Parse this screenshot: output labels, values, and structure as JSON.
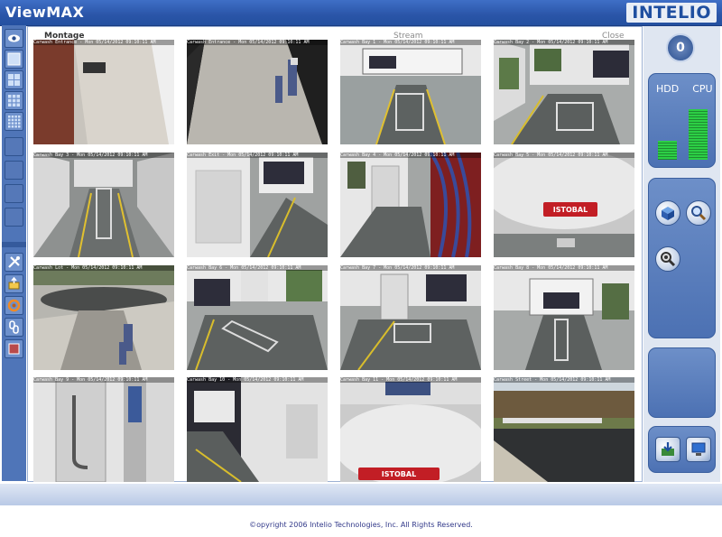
{
  "app": {
    "title": "ViewMAX",
    "logo_text": "INTELIO"
  },
  "tabs": [
    {
      "label": "Montage",
      "active": true
    },
    {
      "label": "Stream",
      "active": false
    },
    {
      "label": "Close",
      "active": false
    }
  ],
  "left_toolbar": {
    "view_buttons": [
      "eye-icon",
      "single-view-icon",
      "quad-view-icon",
      "nine-view-icon",
      "sixteen-view-icon"
    ],
    "tool_buttons": [
      "tools-icon",
      "export-icon",
      "refresh-icon",
      "link-icon",
      "record-icon"
    ]
  },
  "cameras": [
    {
      "stamp": "Carwash Entrance - Mon 05/14/2012 09:10:11 AM"
    },
    {
      "stamp": "Carwash Entrance - Mon 05/14/2012 09:10:11 AM"
    },
    {
      "stamp": "Carwash Bay 1 - Mon 05/14/2012 09:10:11 AM"
    },
    {
      "stamp": "Carwash Bay 2 - Mon 05/14/2012 09:10:11 AM"
    },
    {
      "stamp": "Carwash Bay 3 - Mon 05/14/2012 09:10:11 AM"
    },
    {
      "stamp": "Carwash Exit - Mon 05/14/2012 09:10:11 AM"
    },
    {
      "stamp": "Carwash Bay 4 - Mon 05/14/2012 09:10:11 AM"
    },
    {
      "stamp": "Carwash Bay 5 - Mon 05/14/2012 09:10:11 AM"
    },
    {
      "stamp": "Carwash Lot - Mon 05/14/2012 09:10:11 AM"
    },
    {
      "stamp": "Carwash Bay 6 - Mon 05/14/2012 09:10:11 AM"
    },
    {
      "stamp": "Carwash Bay 7 - Mon 05/14/2012 09:10:11 AM"
    },
    {
      "stamp": "Carwash Bay 8 - Mon 05/14/2012 09:10:11 AM"
    },
    {
      "stamp": "Carwash Bay 9 - Mon 05/14/2012 09:10:11 AM"
    },
    {
      "stamp": "Carwash Bay 10 - Mon 05/14/2012 09:10:11 AM"
    },
    {
      "stamp": "Carwash Bay 11 - Mon 05/14/2012 09:10:11 AM"
    },
    {
      "stamp": "Carwash Street - Mon 05/14/2012 09:10:11 AM"
    }
  ],
  "sidebar": {
    "counter": "0",
    "hdd_label": "HDD",
    "cpu_label": "CPU",
    "hdd_level": 0.3,
    "cpu_level": 0.8,
    "actions": [
      "cube-icon",
      "magnifier-icon",
      "camera-search-icon"
    ],
    "bottom_actions": [
      "save-icon",
      "monitor-icon"
    ]
  },
  "footer": {
    "copyright": "©opyright 2006 Intelio Technologies, Inc. All Rights Reserved."
  },
  "colors": {
    "accent": "#2a55a8",
    "panel": "#4c71b3",
    "meter": "#2ccf45"
  }
}
